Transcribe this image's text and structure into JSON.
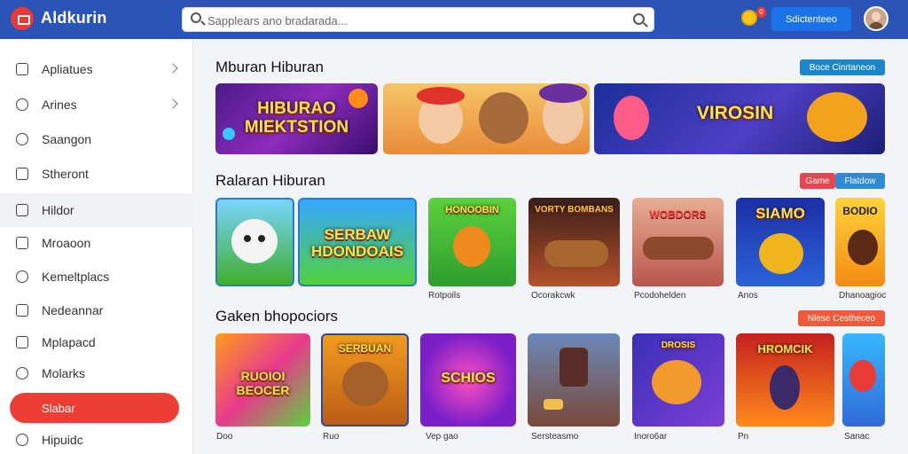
{
  "header": {
    "app_name": "Aldkurin",
    "search_placeholder": "Sapplears ano bradarada...",
    "notification_count": "0",
    "action_button": "Sdictenteeo"
  },
  "sidebar": {
    "items": [
      {
        "label": "Apliatues",
        "icon": "home-icon",
        "chevron": true
      },
      {
        "label": "Arines",
        "icon": "circle-icon",
        "chevron": true
      },
      {
        "label": "Saangon",
        "icon": "cloud-icon",
        "chevron": false
      },
      {
        "label": "Stheront",
        "icon": "bookmark-icon",
        "chevron": false
      },
      {
        "label": "Hildor",
        "icon": "grid-icon",
        "chevron": false
      },
      {
        "label": "Mroaoon",
        "icon": "square-icon",
        "chevron": false
      },
      {
        "label": "Kemeltplacs",
        "icon": "user-icon",
        "chevron": false
      },
      {
        "label": "Nedeannar",
        "icon": "list-icon",
        "chevron": false
      },
      {
        "label": "Mplapacd",
        "icon": "document-icon",
        "chevron": false
      },
      {
        "label": "Molarks",
        "icon": "chat-icon",
        "chevron": false
      }
    ],
    "active_item": "Slabar",
    "last_item": "Hipuidc"
  },
  "sections": [
    {
      "title": "Mburan Hiburan",
      "button": "Boce Cinrtaneon",
      "button_color": "#1b86c9"
    },
    {
      "title": "Ralaran Hiburan",
      "buttons": [
        "Game",
        "Flatdow"
      ],
      "button_colors": [
        "#e8474f",
        "#2f8ad8"
      ]
    },
    {
      "title": "Gaken bhopociors",
      "button": "Nlese Cestheceo",
      "button_color": "#ee5b3a"
    }
  ],
  "banners": [
    {
      "title": "HIBURAO MIEKTSTION"
    },
    {
      "title": ""
    },
    {
      "title": "VIROSIN"
    }
  ],
  "row2": [
    {
      "title": "",
      "caption": ""
    },
    {
      "title": "SERBAW HDONDOAIS",
      "caption": ""
    },
    {
      "title": "HONOOBIN",
      "caption": "Rotpoils"
    },
    {
      "title": "VORTY BOMBANS",
      "caption": "Ocorakcwk"
    },
    {
      "title": "WOBDORS",
      "caption": "Pcodohelden"
    },
    {
      "title": "SIAMO",
      "caption": "Anos"
    },
    {
      "title": "BODIO",
      "caption": "Dhanoagioc"
    }
  ],
  "row3": [
    {
      "title": "RUOIOI BEOCER",
      "caption": "Doo"
    },
    {
      "title": "SERBUAN",
      "caption": "Ruo"
    },
    {
      "title": "SCHIOS",
      "caption": "Vep gao"
    },
    {
      "title": "",
      "caption": "Sersteasmo"
    },
    {
      "title": "DROSIS",
      "caption": "Inoro6ar"
    },
    {
      "title": "HROMCIK",
      "caption": "Pn"
    },
    {
      "title": "",
      "caption": "Sanac"
    }
  ]
}
